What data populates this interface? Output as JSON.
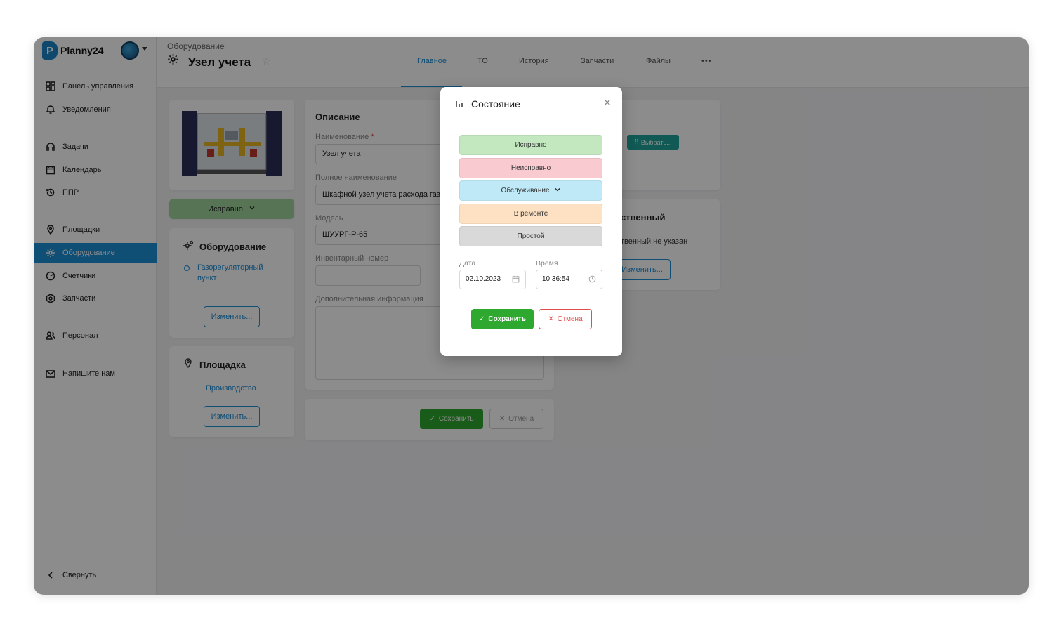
{
  "app": {
    "name": "Planny24"
  },
  "sidebar": {
    "items": [
      {
        "label": "Панель управления",
        "icon": "dashboard-icon"
      },
      {
        "label": "Уведомления",
        "icon": "bell-icon"
      },
      {
        "label": "Задачи",
        "icon": "headset-icon"
      },
      {
        "label": "Календарь",
        "icon": "calendar-icon"
      },
      {
        "label": "ППР",
        "icon": "history-icon"
      },
      {
        "label": "Площадки",
        "icon": "location-icon"
      },
      {
        "label": "Оборудование",
        "icon": "gear-icon"
      },
      {
        "label": "Счетчики",
        "icon": "gauge-icon"
      },
      {
        "label": "Запчасти",
        "icon": "hexagon-icon"
      },
      {
        "label": "Персонал",
        "icon": "users-icon"
      },
      {
        "label": "Напишите нам",
        "icon": "mail-icon"
      }
    ],
    "collapse_label": "Свернуть"
  },
  "header": {
    "breadcrumb": "Оборудование",
    "title": "Узел учета",
    "tabs": [
      "Главное",
      "ТО",
      "История",
      "Запчасти",
      "Файлы",
      "•••"
    ]
  },
  "left": {
    "status_label": "Исправно",
    "equipment_title": "Оборудование",
    "equipment_link": "Газорегуляторный пункт",
    "change_label": "Изменить...",
    "site_title": "Площадка",
    "site_link": "Производство",
    "site_change_label": "Изменить..."
  },
  "description": {
    "title": "Описание",
    "name_label": "Наименование",
    "name_value": "Узел учета",
    "fullname_label": "Полное наименование",
    "fullname_value": "Шкафной узел учета расхода газа",
    "model_label": "Модель",
    "model_value": "ШУУРГ-Р-65",
    "inventory_label": "Инвентарный номер",
    "inventory_value": "",
    "extra_label": "Дополнительная информация",
    "save_label": "Сохранить",
    "cancel_label": "Отмена"
  },
  "right": {
    "select_label": "Выбрать...",
    "responsible_title": "ственный",
    "responsible_text": "твенный не указан",
    "responsible_change": "Изменить..."
  },
  "modal": {
    "title": "Состояние",
    "statuses": [
      {
        "label": "Исправно",
        "color": "#c3e8c0"
      },
      {
        "label": "Неисправно",
        "color": "#f9cbd0"
      },
      {
        "label": "Обслуживание",
        "color": "#bfe9f7"
      },
      {
        "label": "В ремонте",
        "color": "#fde1c2"
      },
      {
        "label": "Простой",
        "color": "#d9d9d9"
      }
    ],
    "date_label": "Дата",
    "date_value": "02.10.2023",
    "time_label": "Время",
    "time_value": "10:36:54",
    "save_label": "Сохранить",
    "cancel_label": "Отмена"
  },
  "colors": {
    "accent": "#1d8ed6",
    "save": "#2ea82e",
    "cancel": "#e34c4c"
  }
}
